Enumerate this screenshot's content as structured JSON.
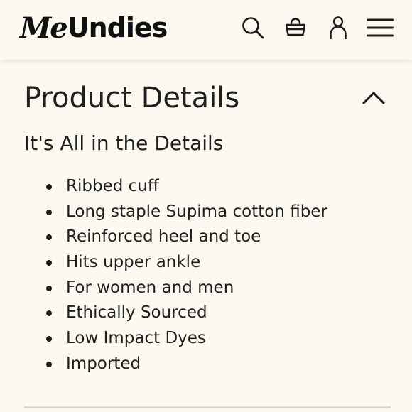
{
  "header": {
    "logo_me": "Me",
    "logo_rest": "Undies",
    "icons": {
      "search": "search-icon",
      "bag": "shopping-bag-icon",
      "account": "user-icon",
      "menu": "hamburger-menu-icon"
    }
  },
  "section": {
    "title": "Product Details",
    "toggle_icon": "chevron-up-icon",
    "expanded": true,
    "subheading": "It's All in the Details",
    "items": [
      "Ribbed cuff",
      "Long staple Supima cotton fiber",
      "Reinforced heel and toe",
      "Hits upper ankle",
      "For women and men",
      "Ethically Sourced",
      "Low Impact Dyes",
      "Imported"
    ]
  },
  "colors": {
    "background": "#fcfaf0",
    "text": "#1f1f1f",
    "divider": "#dcdad0"
  }
}
